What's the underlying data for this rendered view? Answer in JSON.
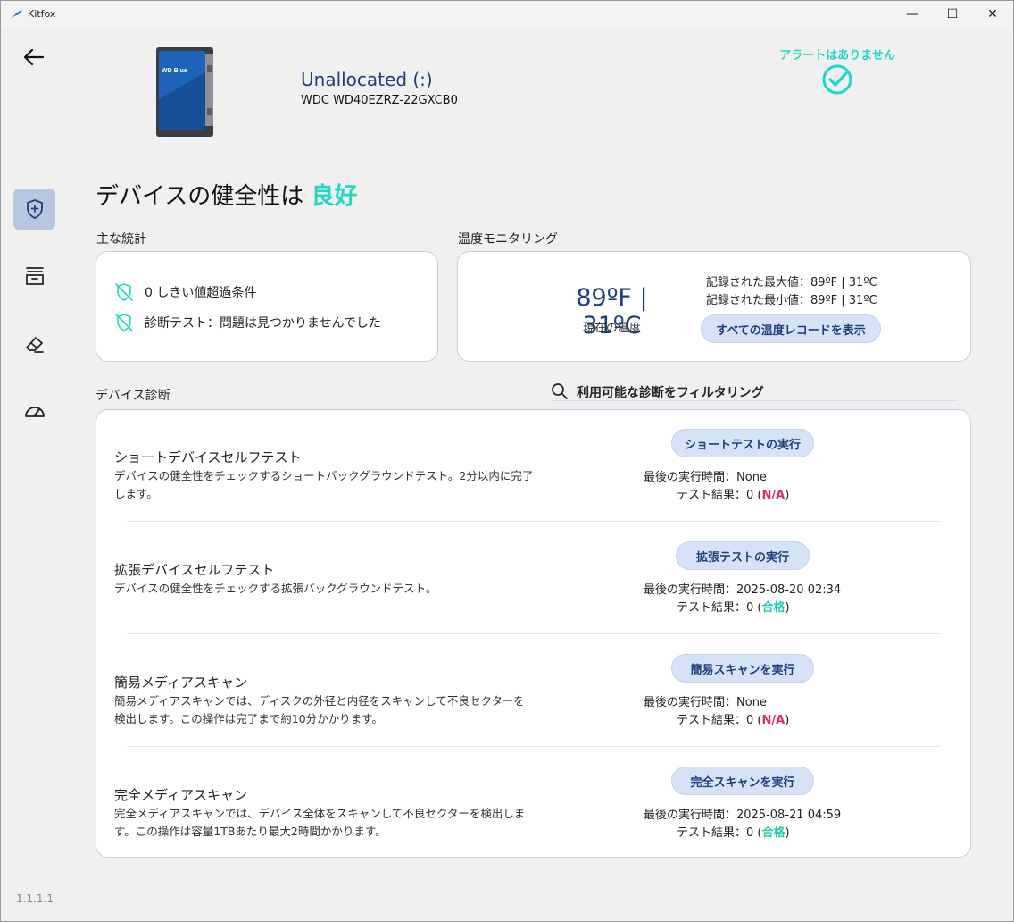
{
  "window": {
    "title": "Kitfox",
    "controls": {
      "minimize": "—",
      "maximize": "☐",
      "close": "✕"
    }
  },
  "sidebar": {
    "items": [
      {
        "name": "health",
        "icon": "shield-plus-icon",
        "active": true
      },
      {
        "name": "storage",
        "icon": "archive-box-icon",
        "active": false
      },
      {
        "name": "erase",
        "icon": "eraser-icon",
        "active": false
      },
      {
        "name": "performance",
        "icon": "speedometer-icon",
        "active": false
      }
    ],
    "version": "1.1.1.1"
  },
  "device": {
    "name": "Unallocated (:)",
    "model": "WDC WD40EZRZ-22GXCB0",
    "image_label": "WD Blue"
  },
  "alerts": {
    "text": "アラートはありません",
    "icon": "check-circle-icon",
    "color": "#1fd8c2"
  },
  "health": {
    "prefix": "デバイスの健全性は",
    "status": "良好",
    "status_color": "#22d9c0"
  },
  "stats": {
    "label": "主な統計",
    "items": [
      {
        "icon": "shield-off-icon",
        "text": "0 しきい値超過条件"
      },
      {
        "icon": "shield-off-icon",
        "text": "診断テスト：問題は見つかりませんでした"
      }
    ]
  },
  "temperature": {
    "label": "温度モニタリング",
    "current": "89ºF | 31ºC",
    "current_label": "現在の温度",
    "max": "記録された最大値：89ºF | 31ºC",
    "min": "記録された最小値：89ºF | 31ºC",
    "button": "すべての温度レコードを表示"
  },
  "diagnostics": {
    "label": "デバイス診断",
    "filter_placeholder": "利用可能な診断をフィルタリング",
    "last_run_label": "最後の実行時間：",
    "result_label": "テスト結果：",
    "tests": [
      {
        "title": "ショートデバイスセルフテスト",
        "description": "デバイスの健全性をチェックするショートバックグラウンドテスト。2分以内に完了します。",
        "button": "ショートテストの実行",
        "last_run": "None",
        "result_count": "0",
        "result_status": "N/A",
        "status_type": "na"
      },
      {
        "title": "拡張デバイスセルフテスト",
        "description": "デバイスの健全性をチェックする拡張バックグラウンドテスト。",
        "button": "拡張テストの実行",
        "last_run": "2025-08-20 02:34",
        "result_count": "0",
        "result_status": "合格",
        "status_type": "pass"
      },
      {
        "title": "簡易メディアスキャン",
        "description": "簡易メディアスキャンでは、ディスクの外径と内径をスキャンして不良セクターを検出します。この操作は完了まで約10分かかります。",
        "button": "簡易スキャンを実行",
        "last_run": "None",
        "result_count": "0",
        "result_status": "N/A",
        "status_type": "na"
      },
      {
        "title": "完全メディアスキャン",
        "description": "完全メディアスキャンでは、デバイス全体をスキャンして不良セクターを検出します。この操作は容量1TBあたり最大2時間かかります。",
        "button": "完全スキャンを実行",
        "last_run": "2025-08-21 04:59",
        "result_count": "0",
        "result_status": "合格",
        "status_type": "pass"
      }
    ]
  },
  "colors": {
    "accent": "#1f3e7a",
    "button_bg": "#d6e2f8",
    "fail": "#e2286a",
    "pass": "#22c9b3"
  }
}
